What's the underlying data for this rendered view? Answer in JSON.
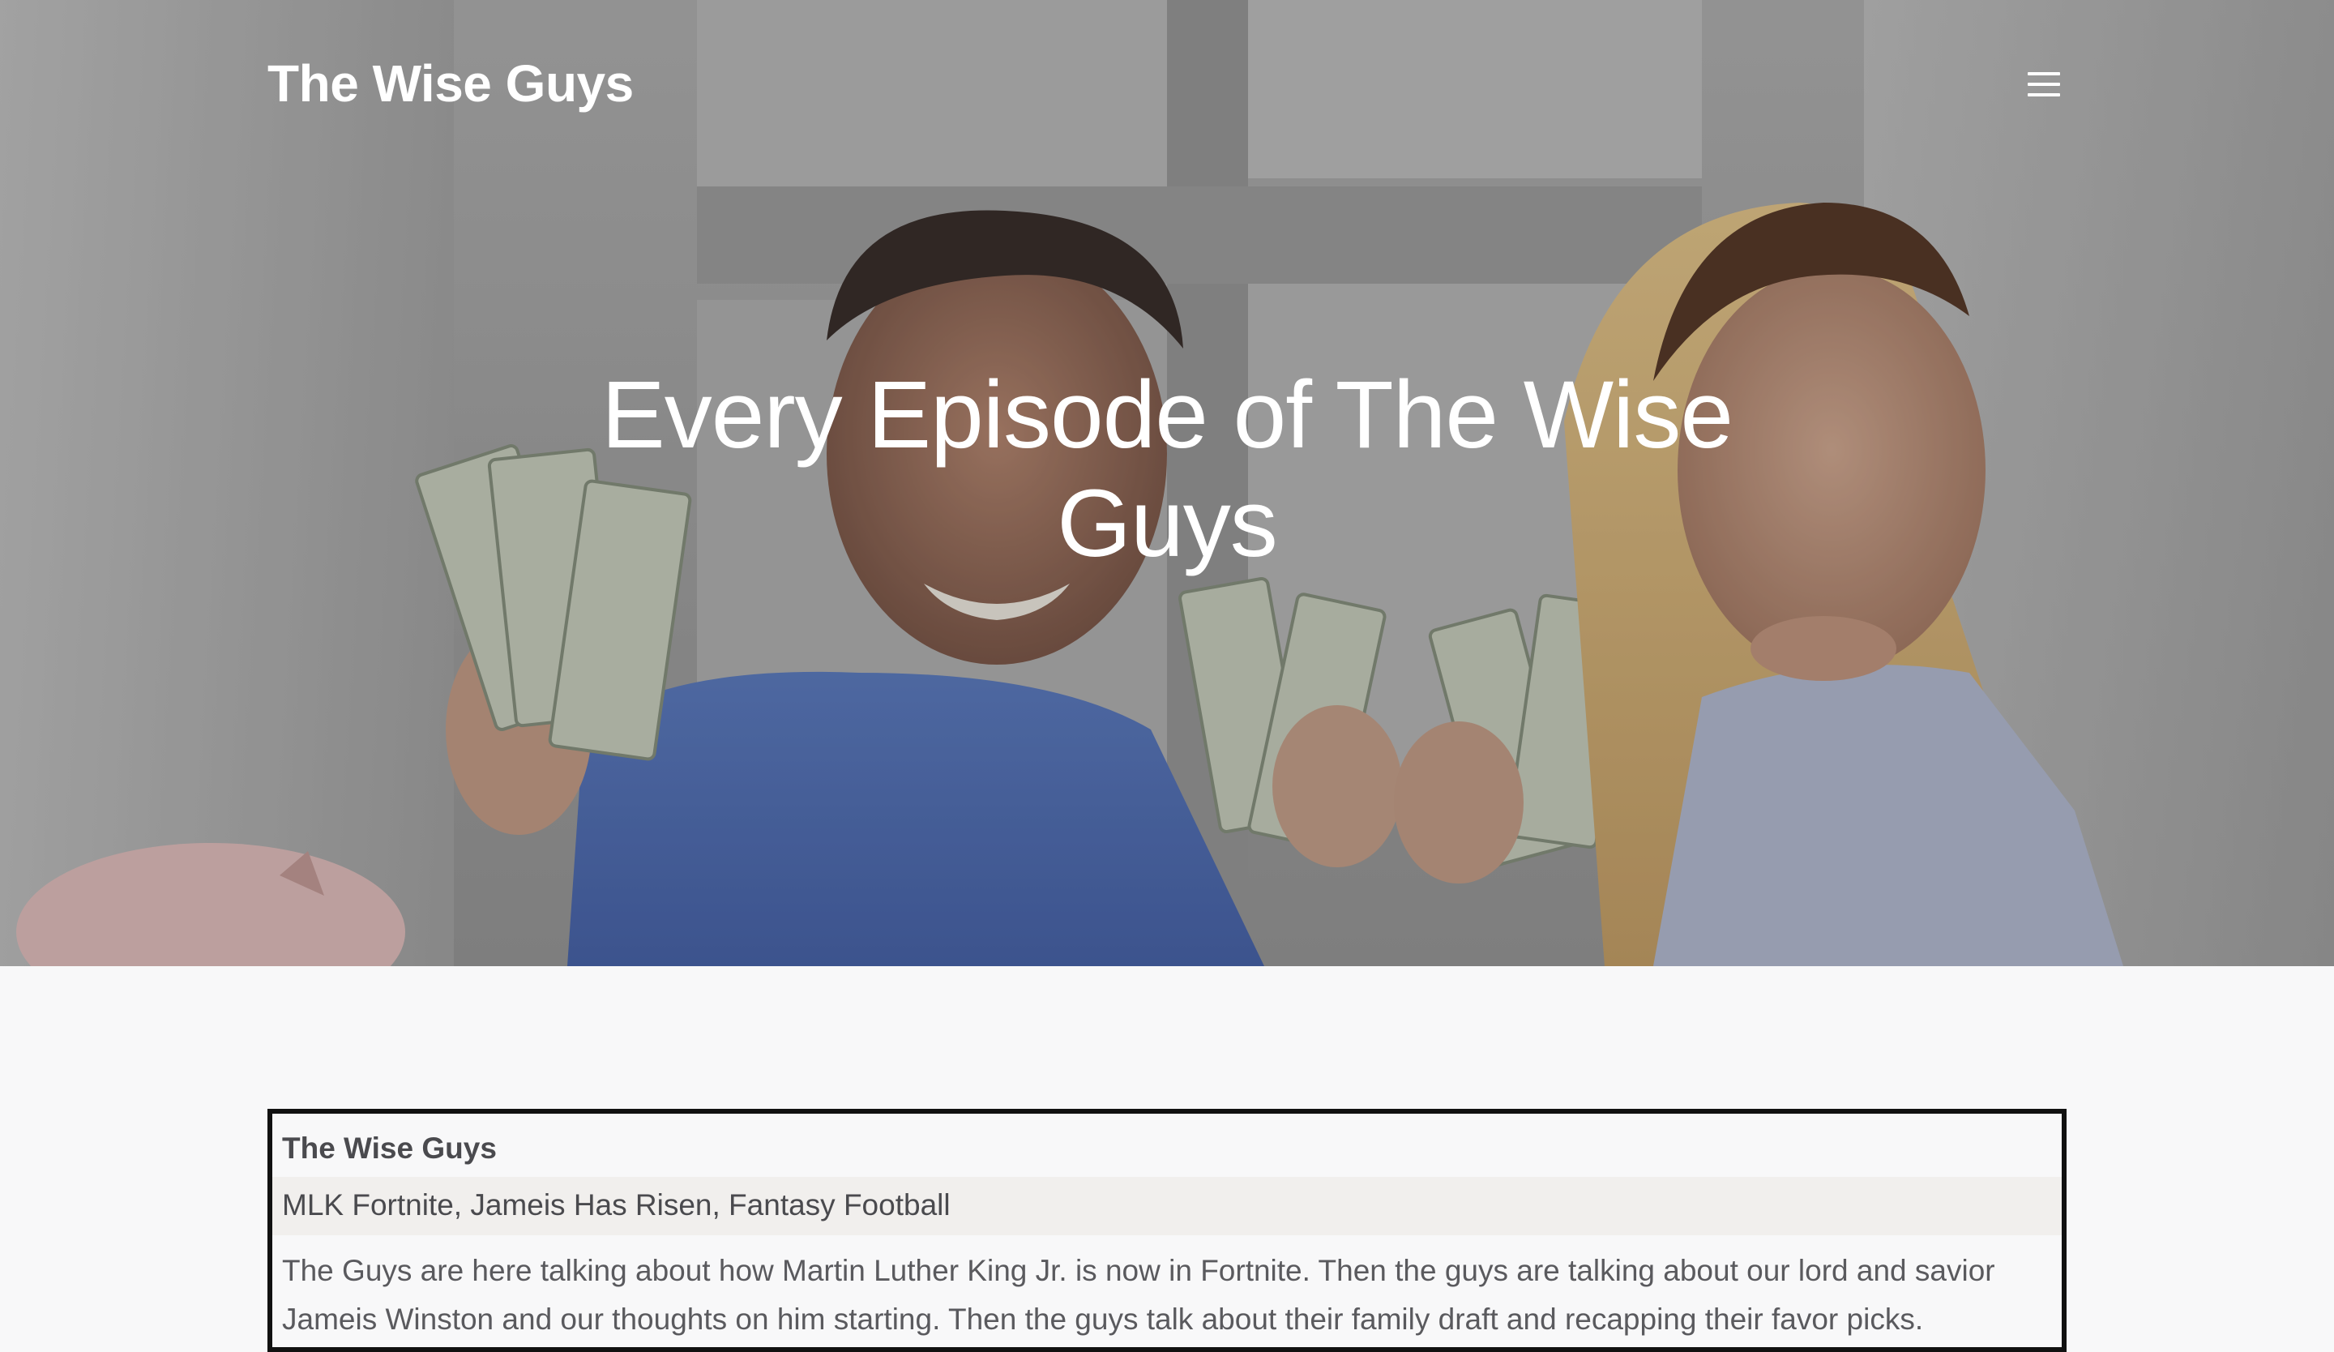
{
  "header": {
    "site_title": "The Wise Guys",
    "menu_icon": "hamburger-menu-icon"
  },
  "hero": {
    "heading": "Every Episode of The Wise Guys"
  },
  "episode_player": {
    "show_name": "The Wise Guys",
    "episode_title": "MLK Fortnite, Jameis Has Risen, Fantasy Football",
    "description": "The Guys are here talking about how Martin Luther King Jr. is now in Fortnite. Then the guys are talking about our lord and savior Jameis Winston and our thoughts on him starting. Then the guys talk about their family draft and recapping their favor picks."
  }
}
